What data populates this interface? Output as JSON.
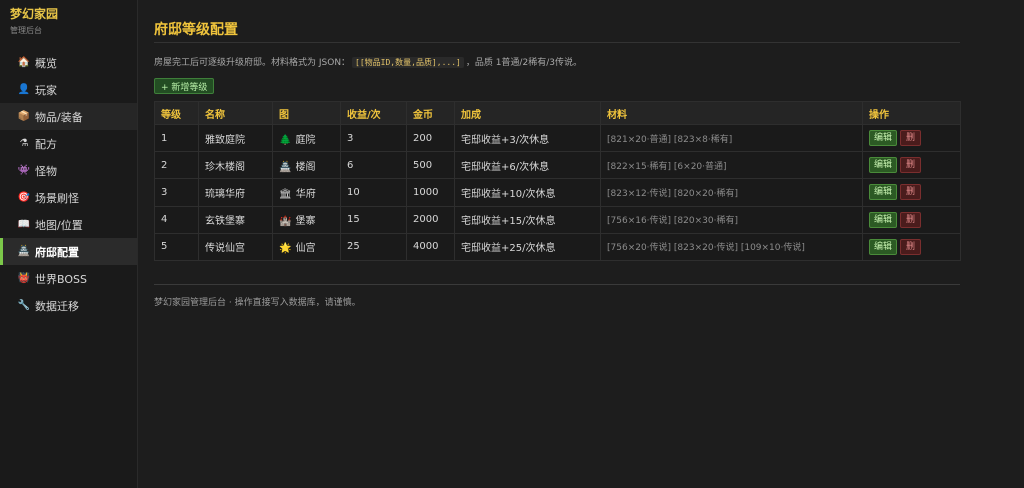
{
  "brand": {
    "title": "梦幻家园",
    "subtitle": "管理后台"
  },
  "sidebar": {
    "items": [
      {
        "icon": "🏠",
        "label": "概览"
      },
      {
        "icon": "👤",
        "label": "玩家"
      },
      {
        "icon": "📦",
        "label": "物品/装备"
      },
      {
        "icon": "⚗",
        "label": "配方"
      },
      {
        "icon": "👾",
        "label": "怪物"
      },
      {
        "icon": "🎯",
        "label": "场景刷怪"
      },
      {
        "icon": "📖",
        "label": "地图/位置"
      },
      {
        "icon": "🏯",
        "label": "府邸配置"
      },
      {
        "icon": "👹",
        "label": "世界BOSS"
      },
      {
        "icon": "🔧",
        "label": "数据迁移"
      }
    ],
    "active": "府邸配置"
  },
  "page": {
    "title": "府邸等级配置",
    "desc_before": "房屋完工后可逐级升级府邸。材料格式为 JSON：",
    "desc_code": "[[物品ID,数量,品质],...]",
    "desc_after": "，品质 1普通/2稀有/3传说。",
    "add_button": "+ 新增等级",
    "footer": "梦幻家园管理后台 · 操作直接写入数据库，请谨慎。"
  },
  "table": {
    "headers": {
      "level": "等级",
      "name": "名称",
      "pic": "图",
      "income": "收益/次",
      "gold": "金币",
      "bonus": "加成",
      "materials": "材料",
      "actions": "操作"
    },
    "edit_label": "编辑",
    "delete_label": "删",
    "rows": [
      {
        "level": "1",
        "name": "雅致庭院",
        "pic_icon": "🌲",
        "pic_label": "庭院",
        "income": "3",
        "gold": "200",
        "bonus": "宅邸收益+3/次休息",
        "materials": "[821×20·普通] [823×8·稀有]"
      },
      {
        "level": "2",
        "name": "珍木楼阁",
        "pic_icon": "🏯",
        "pic_label": "楼阁",
        "income": "6",
        "gold": "500",
        "bonus": "宅邸收益+6/次休息",
        "materials": "[822×15·稀有] [6×20·普通]"
      },
      {
        "level": "3",
        "name": "琉璃华府",
        "pic_icon": "🏛",
        "pic_label": "华府",
        "income": "10",
        "gold": "1000",
        "bonus": "宅邸收益+10/次休息",
        "materials": "[823×12·传说] [820×20·稀有]"
      },
      {
        "level": "4",
        "name": "玄铁堡寨",
        "pic_icon": "🏰",
        "pic_label": "堡寨",
        "income": "15",
        "gold": "2000",
        "bonus": "宅邸收益+15/次休息",
        "materials": "[756×16·传说] [820×30·稀有]"
      },
      {
        "level": "5",
        "name": "传说仙宫",
        "pic_icon": "🌟",
        "pic_label": "仙宫",
        "income": "25",
        "gold": "4000",
        "bonus": "宅邸收益+25/次休息",
        "materials": "[756×20·传说] [823×20·传说] [109×10·传说]"
      }
    ]
  },
  "colors": {
    "accent": "#f0c43c",
    "active_bar": "#7cc84a",
    "edit": "#2c5a24",
    "delete": "#4a1c1c"
  }
}
